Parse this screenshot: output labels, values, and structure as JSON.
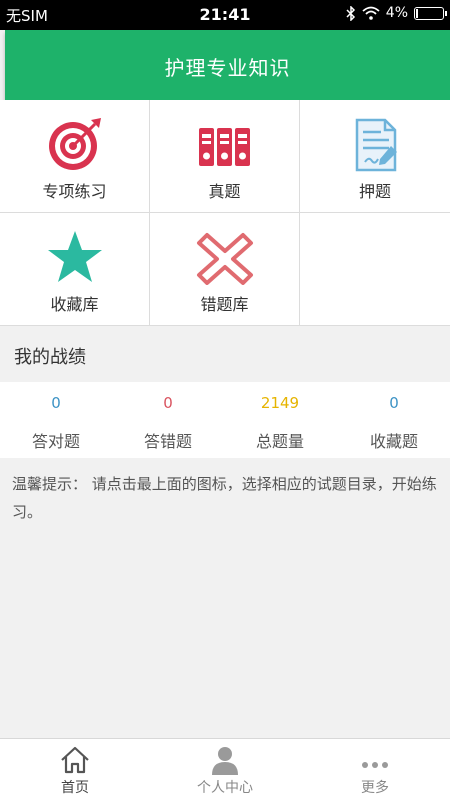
{
  "status_bar": {
    "carrier": "无SIM",
    "time": "21:41",
    "battery": "4%",
    "battery_level": 0.04
  },
  "header": {
    "title": "护理专业知识"
  },
  "grid": {
    "items": [
      {
        "label": "专项练习",
        "icon": "target-icon"
      },
      {
        "label": "真题",
        "icon": "binders-icon"
      },
      {
        "label": "押题",
        "icon": "document-pen-icon"
      },
      {
        "label": "收藏库",
        "icon": "star-icon"
      },
      {
        "label": "错题库",
        "icon": "cross-icon"
      }
    ]
  },
  "stats": {
    "title": "我的战绩",
    "items": [
      {
        "value": "0",
        "label": "答对题",
        "color": "#3d93c5"
      },
      {
        "value": "0",
        "label": "答错题",
        "color": "#d9535f"
      },
      {
        "value": "2149",
        "label": "总题量",
        "color": "#e6b400"
      },
      {
        "value": "0",
        "label": "收藏题",
        "color": "#3d93c5"
      }
    ]
  },
  "tip": "温馨提示： 请点击最上面的图标，选择相应的试题目录，开始练习。",
  "tabbar": {
    "items": [
      {
        "label": "首页",
        "icon": "home-icon"
      },
      {
        "label": "个人中心",
        "icon": "person-icon"
      },
      {
        "label": "更多",
        "icon": "more-dots-icon"
      }
    ]
  },
  "colors": {
    "brand": "#1eb26a",
    "icon_red": "#d9334f",
    "icon_teal": "#2bb9a0",
    "icon_blue": "#6db3da"
  }
}
